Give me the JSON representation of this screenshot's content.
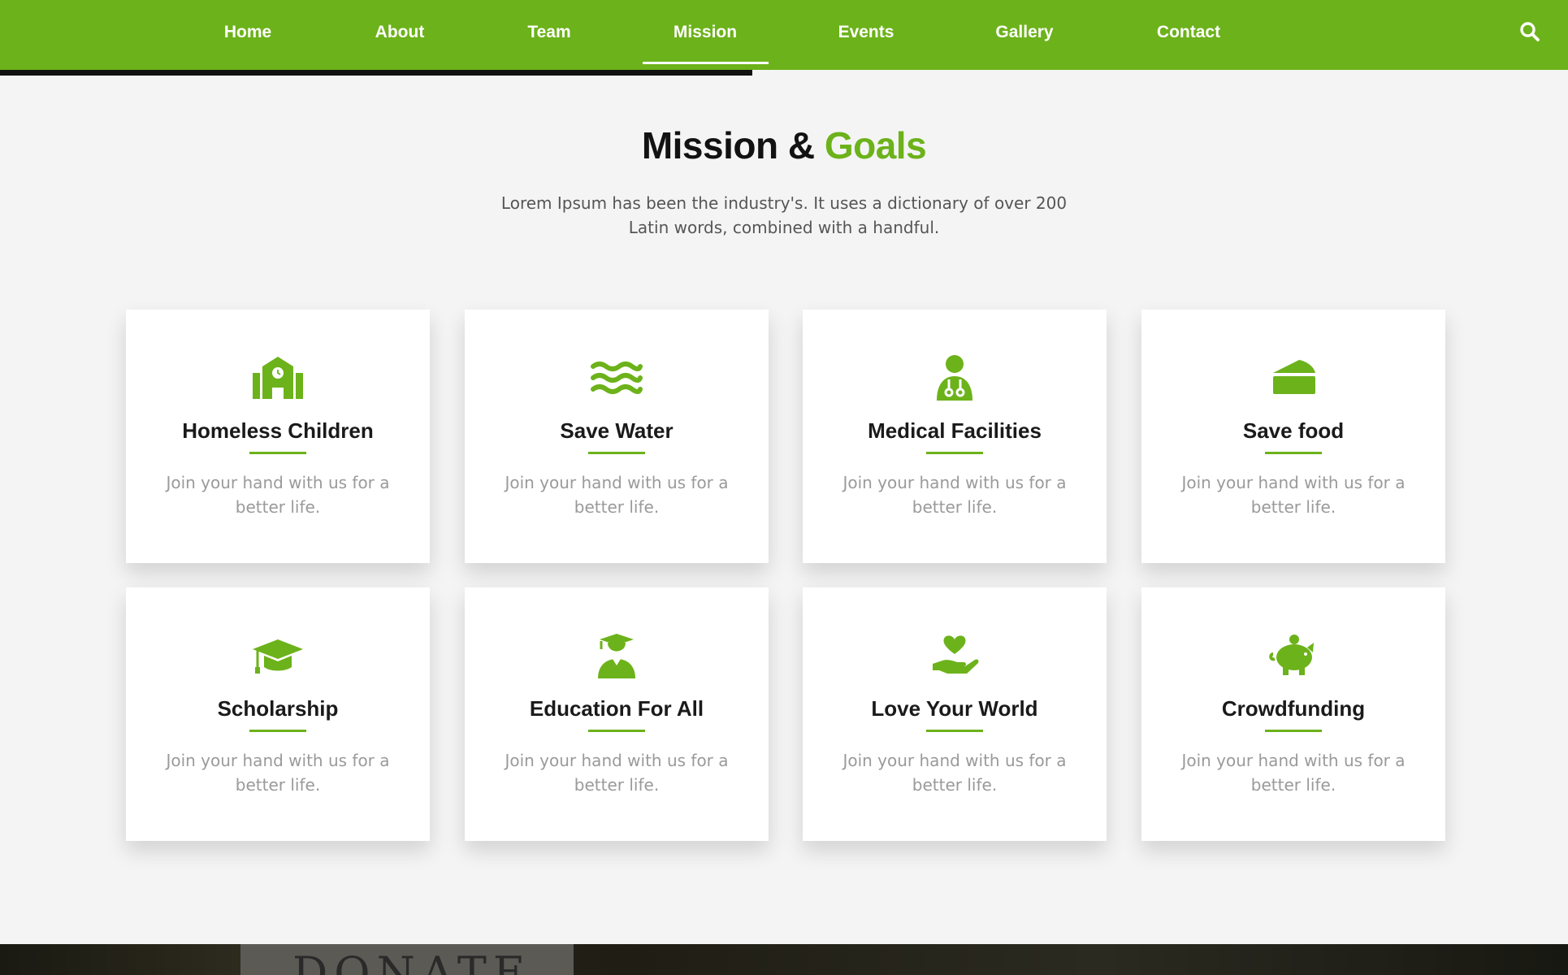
{
  "nav": {
    "items": [
      {
        "label": "Home"
      },
      {
        "label": "About"
      },
      {
        "label": "Team"
      },
      {
        "label": "Mission",
        "active": true
      },
      {
        "label": "Events"
      },
      {
        "label": "Gallery"
      },
      {
        "label": "Contact"
      }
    ],
    "search_icon": "search-icon",
    "scroll_progress_percent": 48
  },
  "section": {
    "title_main": "Mission &",
    "title_accent": "Goals",
    "subtitle": "Lorem Ipsum has been the industry's. It uses a dictionary of over 200 Latin words, combined with a handful."
  },
  "cards": [
    {
      "title": "Homeless Children",
      "text": "Join your hand with us for a better life.",
      "icon": "school-building-icon"
    },
    {
      "title": "Save Water",
      "text": "Join your hand with us for a better life.",
      "icon": "water-waves-icon"
    },
    {
      "title": "Medical Facilities",
      "text": "Join your hand with us for a better life.",
      "icon": "doctor-stethoscope-icon"
    },
    {
      "title": "Save food",
      "text": "Join your hand with us for a better life.",
      "icon": "cheese-icon"
    },
    {
      "title": "Scholarship",
      "text": "Join your hand with us for a better life.",
      "icon": "graduation-cap-icon"
    },
    {
      "title": "Education For All",
      "text": "Join your hand with us for a better life.",
      "icon": "graduate-student-icon"
    },
    {
      "title": "Love Your World",
      "text": "Join your hand with us for a better life.",
      "icon": "heart-in-hand-icon"
    },
    {
      "title": "Crowdfunding",
      "text": "Join your hand with us for a better life.",
      "icon": "piggy-bank-icon"
    }
  ],
  "banner": {
    "word": "DONATE"
  },
  "colors": {
    "accent": "#6cb21a",
    "nav_bg": "#6cb21a",
    "page_bg": "#f4f4f4",
    "heading": "#121212",
    "body_text": "#9a9a9a"
  }
}
